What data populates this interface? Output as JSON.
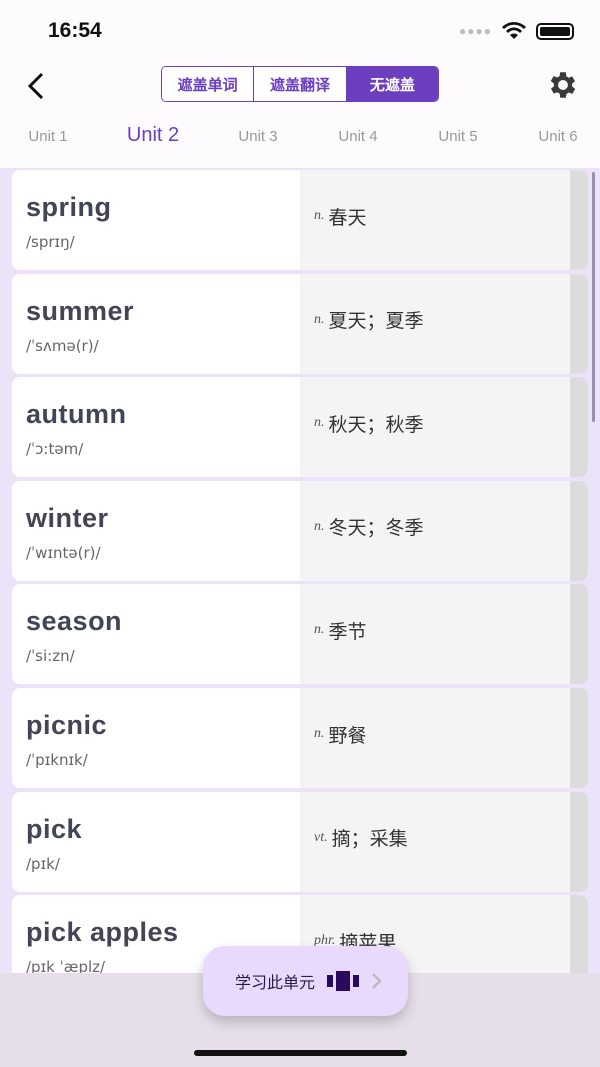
{
  "status": {
    "time": "16:54"
  },
  "header": {
    "segments": [
      "遮盖单词",
      "遮盖翻译",
      "无遮盖"
    ],
    "selected_segment": "无遮盖"
  },
  "tabs": [
    {
      "label": "Unit 1"
    },
    {
      "label": "Unit 2",
      "active": true
    },
    {
      "label": "Unit 3"
    },
    {
      "label": "Unit 4"
    },
    {
      "label": "Unit 5"
    },
    {
      "label": "Unit 6"
    }
  ],
  "words": [
    {
      "word": "spring",
      "phonetic": "/sprɪŋ/",
      "pos": "n.",
      "meaning": "春天"
    },
    {
      "word": "summer",
      "phonetic": "/ˈsʌmə(r)/",
      "pos": "n.",
      "meaning": "夏天；夏季"
    },
    {
      "word": "autumn",
      "phonetic": "/ˈɔ:təm/",
      "pos": "n.",
      "meaning": "秋天；秋季"
    },
    {
      "word": "winter",
      "phonetic": "/ˈwɪntə(r)/",
      "pos": "n.",
      "meaning": "冬天；冬季"
    },
    {
      "word": "season",
      "phonetic": "/ˈsi:zn/",
      "pos": "n.",
      "meaning": "季节"
    },
    {
      "word": "picnic",
      "phonetic": "/ˈpɪknɪk/",
      "pos": "n.",
      "meaning": "野餐"
    },
    {
      "word": "pick",
      "phonetic": "/pɪk/",
      "pos": "vt.",
      "meaning": "摘；采集"
    },
    {
      "word": "pick apples",
      "phonetic": "/pɪk ˈæplz/",
      "pos": "phr.",
      "meaning": "摘苹果"
    }
  ],
  "study_button": {
    "label": "学习此单元"
  },
  "colors": {
    "accent": "#6b3fc0",
    "background": "#ece3fb"
  }
}
